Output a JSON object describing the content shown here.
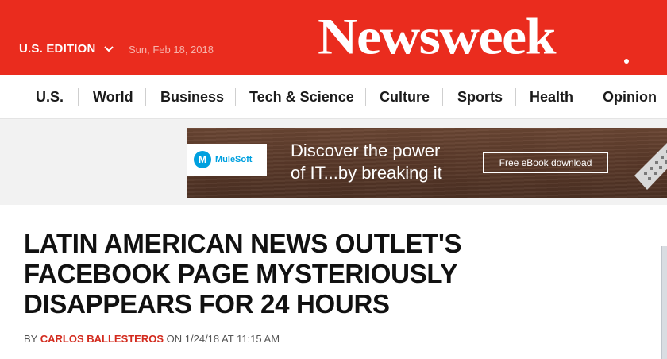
{
  "header": {
    "edition": "U.S. EDITION",
    "date": "Sun, Feb 18, 2018",
    "logo": "Newsweek"
  },
  "nav": {
    "items": [
      "U.S.",
      "World",
      "Business",
      "Tech & Science",
      "Culture",
      "Sports",
      "Health",
      "Opinion"
    ]
  },
  "ad": {
    "brand": "MuleSoft",
    "line1": "Discover the power",
    "line2": "of IT...by breaking it",
    "cta": "Free eBook download"
  },
  "article": {
    "headline": "Latin American News Outlet's Facebook Page Mysteriously Disappears for 24 Hours",
    "by": "BY",
    "author": "CARLOS BALLESTEROS",
    "dateline": "ON 1/24/18 AT 11:15 AM"
  },
  "colors": {
    "brand_red": "#ea2c1e",
    "author_red": "#d32b1e",
    "mulesoft_blue": "#00a0df"
  }
}
